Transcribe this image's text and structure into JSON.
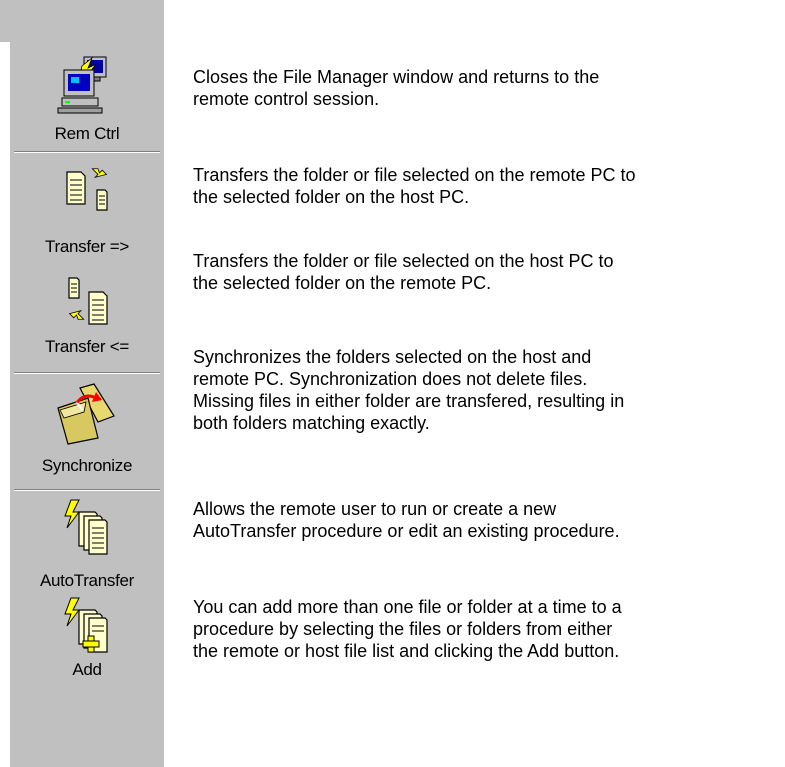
{
  "toolbar": {
    "buttons": [
      {
        "label": "Rem Ctrl",
        "icon": "remote-computer-icon"
      },
      {
        "label": "Transfer =>",
        "icon": "transfer-to-host-icon"
      },
      {
        "label": "Transfer <=",
        "icon": "transfer-to-remote-icon"
      },
      {
        "label": "Synchronize",
        "icon": "synchronize-folder-icon"
      },
      {
        "label": "AutoTransfer",
        "icon": "autotransfer-icon"
      },
      {
        "label": "Add",
        "icon": "add-icon"
      }
    ]
  },
  "descriptions": [
    "Closes the File Manager window and returns to the\nremote control session.",
    "Transfers the folder or file selected on the remote PC to\nthe selected folder on the host PC.",
    "Transfers the folder or file selected on the host PC to\nthe selected folder on the remote PC.",
    "Synchronizes the folders selected on the host and\nremote PC. Synchronization does not delete files.\nMissing files in either folder are transfered, resulting in\nboth folders matching exactly.",
    "Allows the remote user to run or create a new\nAutoTransfer procedure or edit an existing procedure.",
    "You can add more than one file or folder at a time to a\nprocedure by selecting the files or folders from either\nthe remote or host file list and clicking the Add button."
  ],
  "colors": {
    "toolbar_bg": "#c0c0c0",
    "doc_yellow": "#ffffcc",
    "arrow_yellow": "#ffff00",
    "folder_yellow": "#e8d870",
    "bolt_yellow": "#ffff00"
  }
}
